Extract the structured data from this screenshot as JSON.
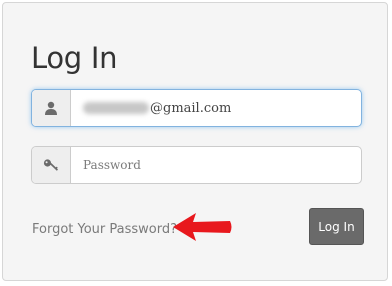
{
  "form": {
    "title": "Log In",
    "email": {
      "value_suffix": "@gmail.com",
      "icon": "user-icon"
    },
    "password": {
      "placeholder": "Password",
      "icon": "key-icon"
    },
    "forgot_link": "Forgot Your Password?",
    "submit_label": "Log In"
  },
  "annotation": {
    "arrow_color": "#e8181d",
    "arrow_icon": "red-arrow-annotation"
  },
  "colors": {
    "button": "#6a6a6a",
    "focus_border": "#82b3df",
    "card_background": "#f5f5f5"
  }
}
